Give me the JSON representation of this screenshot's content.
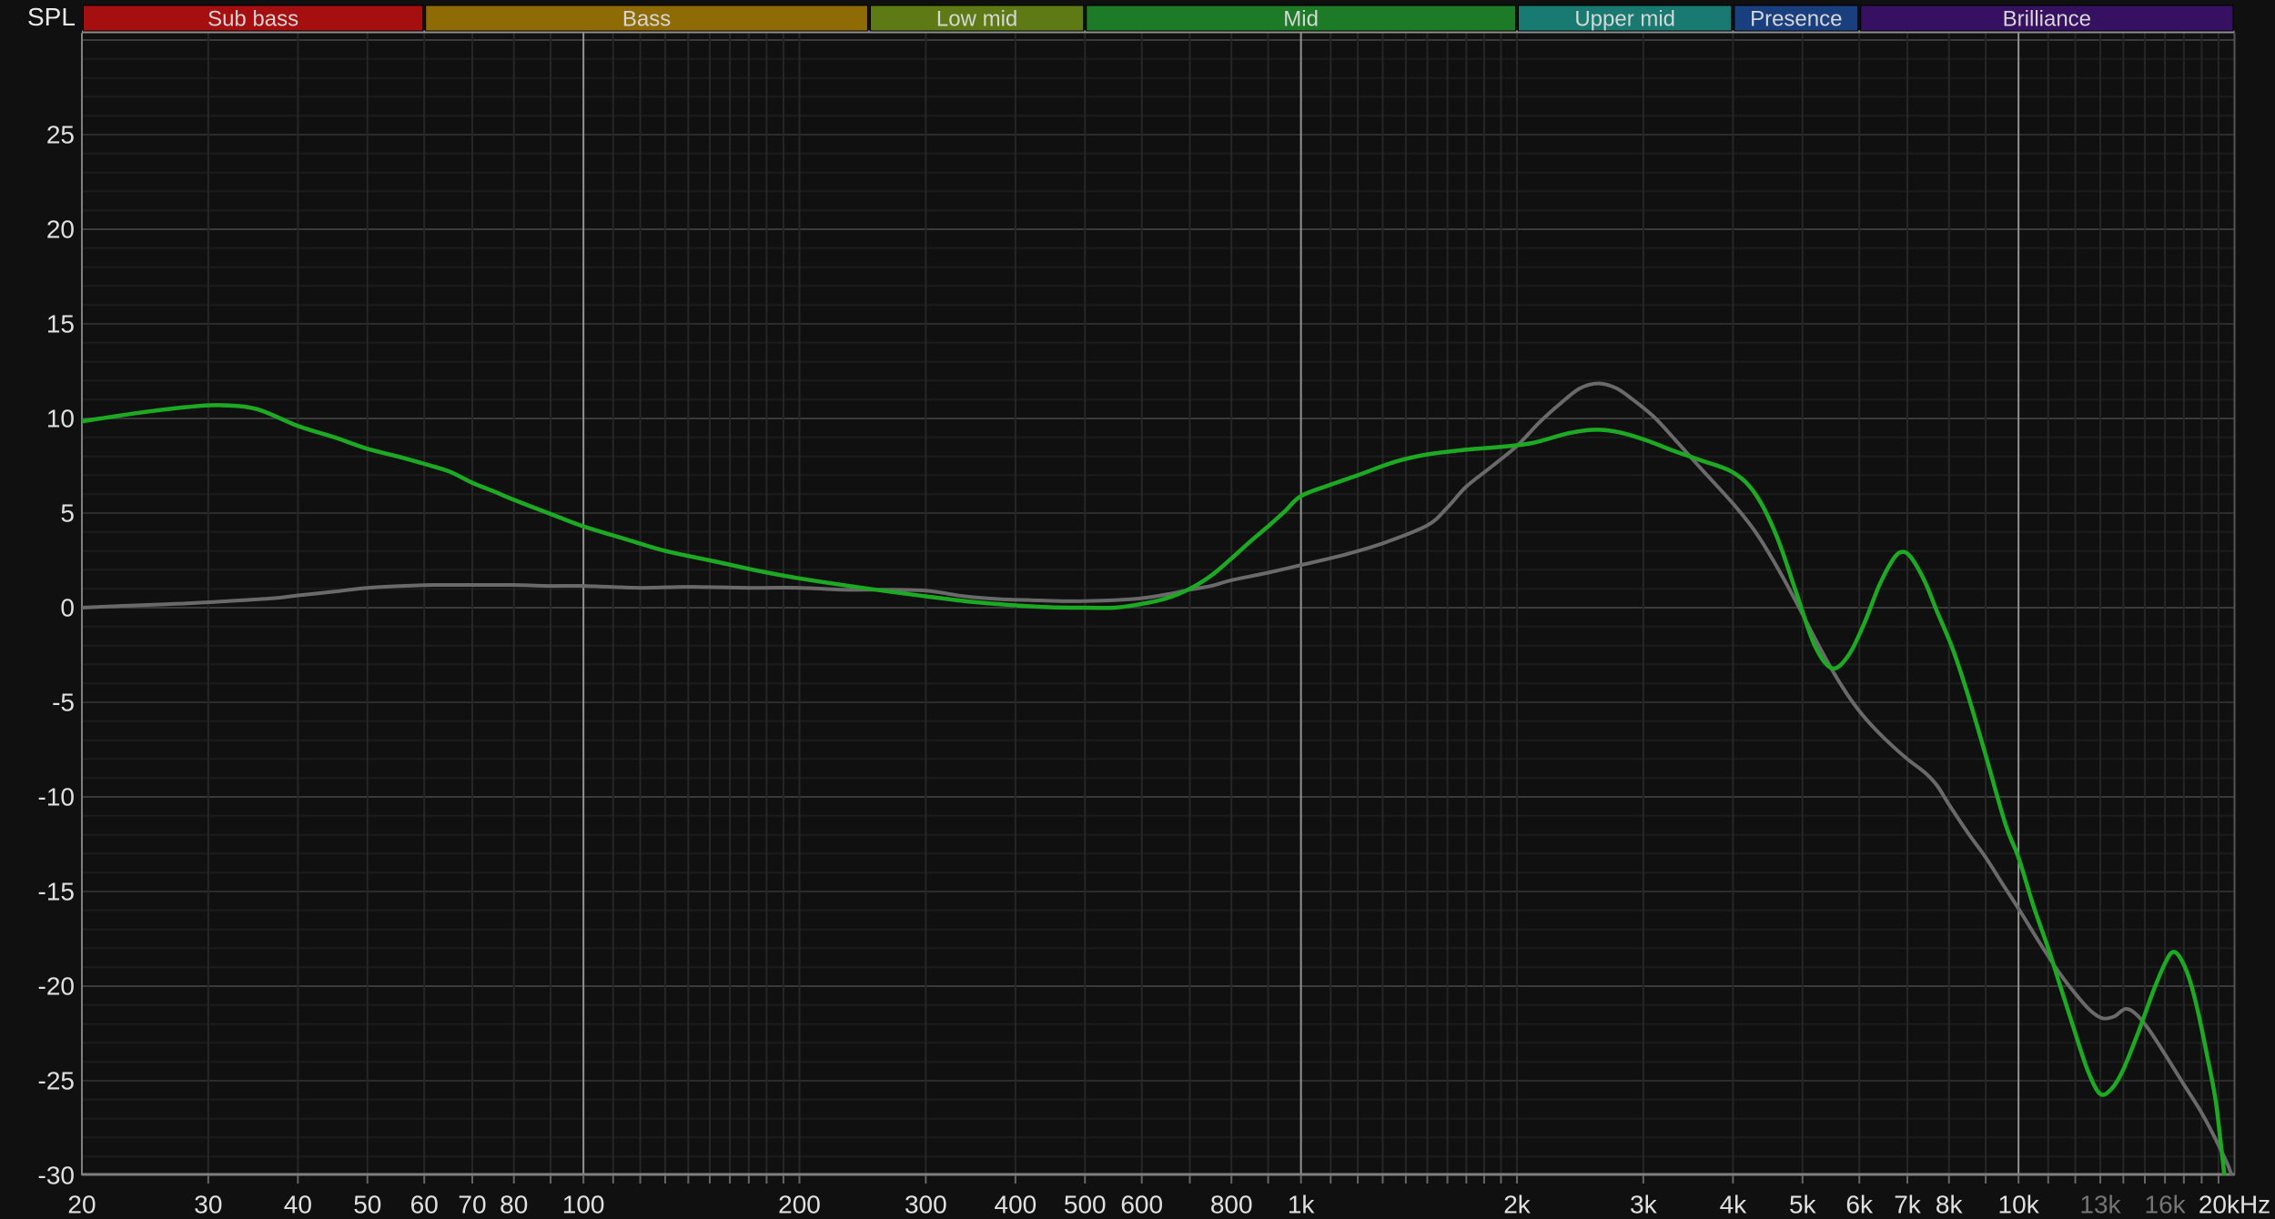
{
  "labels": {
    "spl": "SPL"
  },
  "bands": [
    {
      "label": "Sub bass",
      "color": "#a60f0f",
      "f_start": 20,
      "f_end": 60
    },
    {
      "label": "Bass",
      "color": "#8e6b04",
      "f_start": 60,
      "f_end": 250
    },
    {
      "label": "Low mid",
      "color": "#5d7a14",
      "f_start": 250,
      "f_end": 500
    },
    {
      "label": "Mid",
      "color": "#1d7a26",
      "f_start": 500,
      "f_end": 2000
    },
    {
      "label": "Upper mid",
      "color": "#187a70",
      "f_start": 2000,
      "f_end": 4000
    },
    {
      "label": "Presence",
      "color": "#1a3f7e",
      "f_start": 4000,
      "f_end": 6000
    },
    {
      "label": "Brilliance",
      "color": "#361061",
      "f_start": 6000,
      "f_end": 20000
    }
  ],
  "axes": {
    "y_ticks": [
      {
        "label": "25",
        "db": 25
      },
      {
        "label": "20",
        "db": 20
      },
      {
        "label": "15",
        "db": 15
      },
      {
        "label": "10",
        "db": 10
      },
      {
        "label": "5",
        "db": 5
      },
      {
        "label": "0",
        "db": 0
      },
      {
        "label": "-5",
        "db": -5
      },
      {
        "label": "-10",
        "db": -10
      },
      {
        "label": "-15",
        "db": -15
      },
      {
        "label": "-20",
        "db": -20
      },
      {
        "label": "-25",
        "db": -25
      },
      {
        "label": "-30",
        "db": -30
      }
    ],
    "x_ticks": [
      {
        "label": "20",
        "f": 20,
        "dim": false
      },
      {
        "label": "30",
        "f": 30,
        "dim": false
      },
      {
        "label": "40",
        "f": 40,
        "dim": false
      },
      {
        "label": "50",
        "f": 50,
        "dim": false
      },
      {
        "label": "60",
        "f": 60,
        "dim": false
      },
      {
        "label": "70",
        "f": 70,
        "dim": false
      },
      {
        "label": "80",
        "f": 80,
        "dim": false
      },
      {
        "label": "100",
        "f": 100,
        "dim": false
      },
      {
        "label": "200",
        "f": 200,
        "dim": false
      },
      {
        "label": "300",
        "f": 300,
        "dim": false
      },
      {
        "label": "400",
        "f": 400,
        "dim": false
      },
      {
        "label": "500",
        "f": 500,
        "dim": false
      },
      {
        "label": "600",
        "f": 600,
        "dim": false
      },
      {
        "label": "800",
        "f": 800,
        "dim": false
      },
      {
        "label": "1k",
        "f": 1000,
        "dim": false
      },
      {
        "label": "2k",
        "f": 2000,
        "dim": false
      },
      {
        "label": "3k",
        "f": 3000,
        "dim": false
      },
      {
        "label": "4k",
        "f": 4000,
        "dim": false
      },
      {
        "label": "5k",
        "f": 5000,
        "dim": false
      },
      {
        "label": "6k",
        "f": 6000,
        "dim": false
      },
      {
        "label": "7k",
        "f": 7000,
        "dim": false
      },
      {
        "label": "8k",
        "f": 8000,
        "dim": false
      },
      {
        "label": "10k",
        "f": 10000,
        "dim": false
      },
      {
        "label": "13k",
        "f": 13000,
        "dim": true
      },
      {
        "label": "16k",
        "f": 16000,
        "dim": true
      },
      {
        "label": "20kHz",
        "f": 20000,
        "dim": false
      }
    ]
  },
  "colors": {
    "background": "#101010",
    "grid_minor_h": "#1c1c1c",
    "grid_5db_h": "#2c2c2c",
    "grid_10db_h": "#3a3a3a",
    "grid_minor_v": "#262626",
    "grid_decade_v": "#939393",
    "axis_line": "#808080",
    "plot_border": "#555555",
    "top_border": "#909090",
    "tick_mark": "#666666",
    "tick_label": "#e0e0e0",
    "tick_label_dim": "#757575",
    "band_label": "#d6d6d6",
    "spl_label": "#e8e8e8",
    "series_green": "#1caa22",
    "series_gray": "#6a6a6a"
  },
  "chart_data": {
    "type": "line",
    "xscale": "log",
    "x_range": [
      20,
      20000
    ],
    "y_range": [
      -30,
      30.4
    ],
    "ylabel": "SPL",
    "grid": "on",
    "legend": "none",
    "series": [
      {
        "name": "gray",
        "color": "#6a6a6a",
        "points": [
          [
            20,
            0.0
          ],
          [
            23,
            0.1
          ],
          [
            27,
            0.2
          ],
          [
            32,
            0.35
          ],
          [
            37,
            0.5
          ],
          [
            40,
            0.65
          ],
          [
            45,
            0.85
          ],
          [
            50,
            1.05
          ],
          [
            56,
            1.15
          ],
          [
            62,
            1.2
          ],
          [
            70,
            1.2
          ],
          [
            80,
            1.2
          ],
          [
            90,
            1.15
          ],
          [
            100,
            1.15
          ],
          [
            120,
            1.05
          ],
          [
            140,
            1.1
          ],
          [
            170,
            1.05
          ],
          [
            200,
            1.05
          ],
          [
            230,
            0.95
          ],
          [
            260,
            0.95
          ],
          [
            300,
            0.9
          ],
          [
            340,
            0.6
          ],
          [
            380,
            0.45
          ],
          [
            420,
            0.4
          ],
          [
            460,
            0.35
          ],
          [
            500,
            0.35
          ],
          [
            550,
            0.4
          ],
          [
            600,
            0.5
          ],
          [
            650,
            0.7
          ],
          [
            700,
            0.95
          ],
          [
            750,
            1.15
          ],
          [
            800,
            1.45
          ],
          [
            900,
            1.85
          ],
          [
            1000,
            2.25
          ],
          [
            1150,
            2.8
          ],
          [
            1300,
            3.4
          ],
          [
            1500,
            4.35
          ],
          [
            1600,
            5.3
          ],
          [
            1700,
            6.4
          ],
          [
            1850,
            7.5
          ],
          [
            2000,
            8.55
          ],
          [
            2150,
            9.8
          ],
          [
            2300,
            10.8
          ],
          [
            2450,
            11.6
          ],
          [
            2600,
            11.85
          ],
          [
            2750,
            11.6
          ],
          [
            2900,
            11.0
          ],
          [
            3100,
            10.1
          ],
          [
            3300,
            9.0
          ],
          [
            3600,
            7.4
          ],
          [
            4000,
            5.5
          ],
          [
            4300,
            4.0
          ],
          [
            4600,
            2.2
          ],
          [
            4900,
            0.3
          ],
          [
            5200,
            -1.6
          ],
          [
            5500,
            -3.3
          ],
          [
            5800,
            -4.7
          ],
          [
            6100,
            -5.8
          ],
          [
            6500,
            -6.9
          ],
          [
            7000,
            -8.0
          ],
          [
            7400,
            -8.7
          ],
          [
            7700,
            -9.4
          ],
          [
            8000,
            -10.4
          ],
          [
            8500,
            -11.9
          ],
          [
            9000,
            -13.2
          ],
          [
            9500,
            -14.6
          ],
          [
            10000,
            -15.9
          ],
          [
            10700,
            -17.7
          ],
          [
            11400,
            -19.3
          ],
          [
            12000,
            -20.4
          ],
          [
            12600,
            -21.3
          ],
          [
            13100,
            -21.7
          ],
          [
            13600,
            -21.6
          ],
          [
            14100,
            -21.2
          ],
          [
            14600,
            -21.5
          ],
          [
            15200,
            -22.3
          ],
          [
            16000,
            -23.6
          ],
          [
            17000,
            -25.2
          ],
          [
            18000,
            -26.7
          ],
          [
            19000,
            -28.4
          ],
          [
            19600,
            -29.5
          ],
          [
            19900,
            -30.2
          ]
        ]
      },
      {
        "name": "green",
        "color": "#1caa22",
        "points": [
          [
            20,
            9.85
          ],
          [
            24,
            10.3
          ],
          [
            28,
            10.6
          ],
          [
            31,
            10.7
          ],
          [
            35,
            10.5
          ],
          [
            40,
            9.6
          ],
          [
            45,
            9.0
          ],
          [
            50,
            8.4
          ],
          [
            55,
            8.0
          ],
          [
            60,
            7.6
          ],
          [
            65,
            7.2
          ],
          [
            70,
            6.6
          ],
          [
            75,
            6.15
          ],
          [
            80,
            5.7
          ],
          [
            90,
            4.95
          ],
          [
            100,
            4.3
          ],
          [
            115,
            3.6
          ],
          [
            130,
            3.0
          ],
          [
            150,
            2.5
          ],
          [
            175,
            1.95
          ],
          [
            200,
            1.55
          ],
          [
            250,
            1.0
          ],
          [
            300,
            0.6
          ],
          [
            350,
            0.3
          ],
          [
            400,
            0.12
          ],
          [
            450,
            0.02
          ],
          [
            500,
            0.0
          ],
          [
            550,
            0.0
          ],
          [
            600,
            0.2
          ],
          [
            650,
            0.5
          ],
          [
            700,
            1.0
          ],
          [
            750,
            1.7
          ],
          [
            800,
            2.6
          ],
          [
            850,
            3.5
          ],
          [
            900,
            4.3
          ],
          [
            950,
            5.1
          ],
          [
            1000,
            5.9
          ],
          [
            1100,
            6.5
          ],
          [
            1200,
            7.0
          ],
          [
            1350,
            7.7
          ],
          [
            1500,
            8.1
          ],
          [
            1700,
            8.35
          ],
          [
            1900,
            8.5
          ],
          [
            2100,
            8.7
          ],
          [
            2350,
            9.2
          ],
          [
            2550,
            9.4
          ],
          [
            2750,
            9.3
          ],
          [
            3000,
            8.9
          ],
          [
            3300,
            8.3
          ],
          [
            3600,
            7.8
          ],
          [
            4000,
            7.15
          ],
          [
            4300,
            6.0
          ],
          [
            4600,
            3.8
          ],
          [
            4900,
            0.8
          ],
          [
            5200,
            -2.0
          ],
          [
            5500,
            -3.2
          ],
          [
            5800,
            -2.5
          ],
          [
            6100,
            -0.8
          ],
          [
            6400,
            1.2
          ],
          [
            6700,
            2.6
          ],
          [
            6900,
            2.95
          ],
          [
            7100,
            2.6
          ],
          [
            7400,
            1.4
          ],
          [
            7700,
            -0.2
          ],
          [
            8100,
            -2.2
          ],
          [
            8500,
            -4.6
          ],
          [
            9000,
            -7.8
          ],
          [
            9600,
            -11.5
          ],
          [
            10000,
            -13.2
          ],
          [
            10500,
            -15.8
          ],
          [
            11000,
            -18.0
          ],
          [
            11500,
            -20.3
          ],
          [
            12000,
            -22.5
          ],
          [
            12500,
            -24.5
          ],
          [
            13000,
            -25.7
          ],
          [
            13500,
            -25.4
          ],
          [
            14000,
            -24.4
          ],
          [
            14700,
            -22.4
          ],
          [
            15400,
            -20.3
          ],
          [
            16000,
            -18.8
          ],
          [
            16400,
            -18.2
          ],
          [
            16800,
            -18.5
          ],
          [
            17300,
            -19.6
          ],
          [
            17800,
            -21.4
          ],
          [
            18300,
            -23.6
          ],
          [
            18800,
            -25.9
          ],
          [
            19100,
            -28.0
          ],
          [
            19400,
            -30.3
          ]
        ]
      }
    ]
  }
}
